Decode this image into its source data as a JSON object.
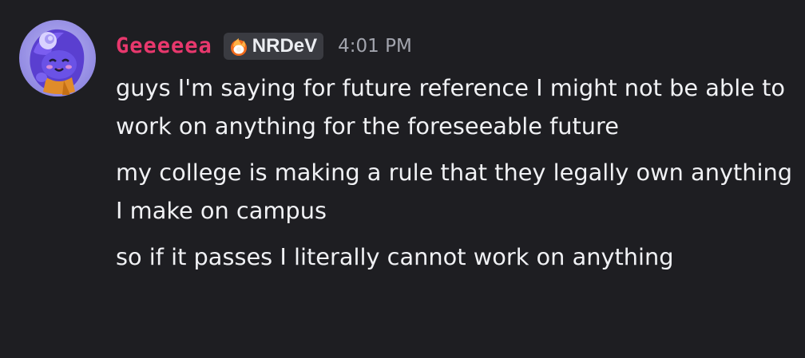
{
  "message": {
    "author": {
      "username": "Geeeeea",
      "name_color": "#e8386d",
      "avatar_icon": "avatar-image",
      "tag": {
        "icon": "flame-icon",
        "label": "NRDeV"
      }
    },
    "timestamp": "4:01 PM",
    "lines": [
      "guys I'm saying for future reference I might not be able to work on anything for the foreseeable future",
      "my college is making a rule that they legally own anything I make on campus",
      "so if it passes I literally cannot work on anything"
    ]
  }
}
